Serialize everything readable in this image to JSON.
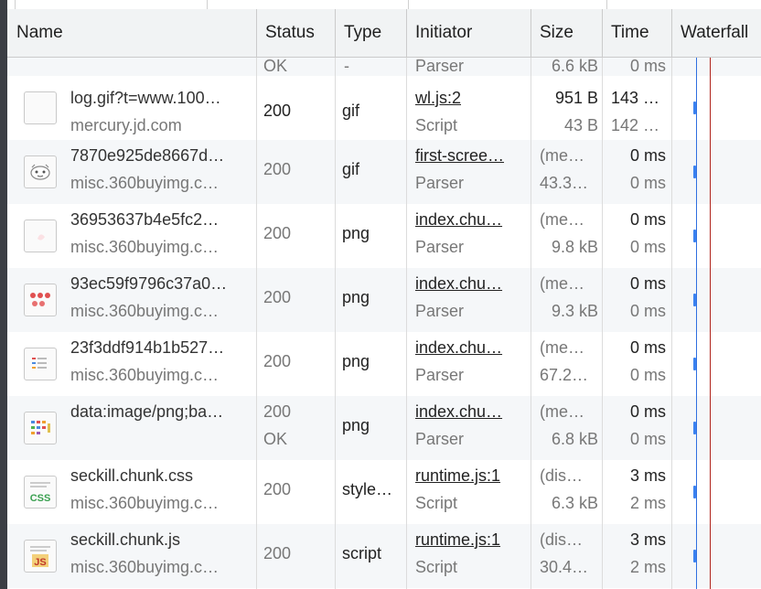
{
  "columns": [
    "Name",
    "Status",
    "Type",
    "Initiator",
    "Size",
    "Time",
    "Waterfall"
  ],
  "partial_row": {
    "status": "OK",
    "type": "-",
    "initiator": "Parser",
    "size": "6.6 kB",
    "time": "0 ms"
  },
  "rows": [
    {
      "name": "log.gif?t=www.100…",
      "domain": "mercury.jd.com",
      "status": "200",
      "status2": "",
      "type": "gif",
      "initiator": "wl.js:2",
      "initiator_sub": "Script",
      "size": "951 B",
      "size2": "43 B",
      "time": "143 …",
      "time2": "142 …",
      "thumb_icon": "blank-image-icon"
    },
    {
      "name": "7870e925de8667d…",
      "domain": "misc.360buyimg.c…",
      "status": "200",
      "status2": "",
      "type": "gif",
      "initiator": "first-scree…",
      "initiator_sub": "Parser",
      "size": "(me…",
      "size2": "43.3…",
      "time": "0 ms",
      "time2": "0 ms",
      "thumb_icon": "mascot-image-icon"
    },
    {
      "name": "36953637b4e5fc2…",
      "domain": "misc.360buyimg.c…",
      "status": "200",
      "status2": "",
      "type": "png",
      "initiator": "index.chu…",
      "initiator_sub": "Parser",
      "size": "(me…",
      "size2": "9.8 kB",
      "time": "0 ms",
      "time2": "0 ms",
      "thumb_icon": "pink-image-icon"
    },
    {
      "name": "93ec59f9796c37a0…",
      "domain": "misc.360buyimg.c…",
      "status": "200",
      "status2": "",
      "type": "png",
      "initiator": "index.chu…",
      "initiator_sub": "Parser",
      "size": "(me…",
      "size2": "9.3 kB",
      "time": "0 ms",
      "time2": "0 ms",
      "thumb_icon": "red-sprite-image-icon"
    },
    {
      "name": "23f3ddf914b1b527…",
      "domain": "misc.360buyimg.c…",
      "status": "200",
      "status2": "",
      "type": "png",
      "initiator": "index.chu…",
      "initiator_sub": "Parser",
      "size": "(me…",
      "size2": "67.2…",
      "time": "0 ms",
      "time2": "0 ms",
      "thumb_icon": "list-image-icon"
    },
    {
      "name": "data:image/png;ba…",
      "domain": "",
      "status": "200",
      "status2": "OK",
      "type": "png",
      "initiator": "index.chu…",
      "initiator_sub": "Parser",
      "size": "(me…",
      "size2": "6.8 kB",
      "time": "0 ms",
      "time2": "0 ms",
      "thumb_icon": "colorful-sprite-image-icon"
    },
    {
      "name": "seckill.chunk.css",
      "domain": "misc.360buyimg.c…",
      "status": "200",
      "status2": "",
      "type": "style…",
      "initiator": "runtime.js:1",
      "initiator_sub": "Script",
      "size": "(dis…",
      "size2": "6.3 kB",
      "time": "3 ms",
      "time2": "2 ms",
      "thumb_icon": "css-file-icon"
    },
    {
      "name": "seckill.chunk.js",
      "domain": "misc.360buyimg.c…",
      "status": "200",
      "status2": "",
      "type": "script",
      "initiator": "runtime.js:1",
      "initiator_sub": "Script",
      "size": "(dis…",
      "size2": "30.4…",
      "time": "3 ms",
      "time2": "2 ms",
      "thumb_icon": "js-file-icon"
    }
  ],
  "colors": {
    "waterfall_blue": "#2f6fe0",
    "waterfall_red": "#b0241c",
    "row_alt": "#f5f7f9",
    "header_bg": "#f1f3f4"
  }
}
